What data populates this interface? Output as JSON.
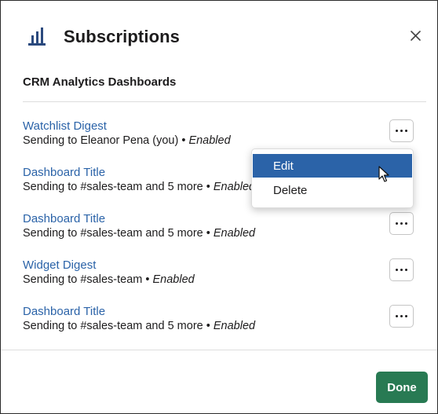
{
  "header": {
    "title": "Subscriptions",
    "subtitle": "CRM Analytics Dashboards"
  },
  "subscriptions": [
    {
      "title": "Watchlist Digest",
      "desc_prefix": "Sending to Eleanor Pena (you) • ",
      "status": "Enabled"
    },
    {
      "title": "Dashboard Title",
      "desc_prefix": "Sending to #sales-team and 5 more  • ",
      "status": "Enabled"
    },
    {
      "title": "Dashboard Title",
      "desc_prefix": "Sending to #sales-team and 5 more  • ",
      "status": "Enabled"
    },
    {
      "title": "Widget Digest",
      "desc_prefix": "Sending to #sales-team • ",
      "status": "Enabled"
    },
    {
      "title": "Dashboard Title",
      "desc_prefix": "Sending to #sales-team and 5 more  • ",
      "status": "Enabled"
    }
  ],
  "menu": {
    "items": [
      {
        "label": "Edit",
        "highlighted": true
      },
      {
        "label": "Delete",
        "highlighted": false
      }
    ]
  },
  "footer": {
    "done_label": "Done"
  },
  "icons": {
    "logo": "bar-chart-icon",
    "close": "close-icon",
    "more": "more-horizontal-icon",
    "cursor": "mouse-pointer-icon"
  },
  "colors": {
    "link": "#2b63a8",
    "menu_highlight": "#2b63a8",
    "done_button": "#287a53",
    "logo": "#2b4a7e"
  }
}
